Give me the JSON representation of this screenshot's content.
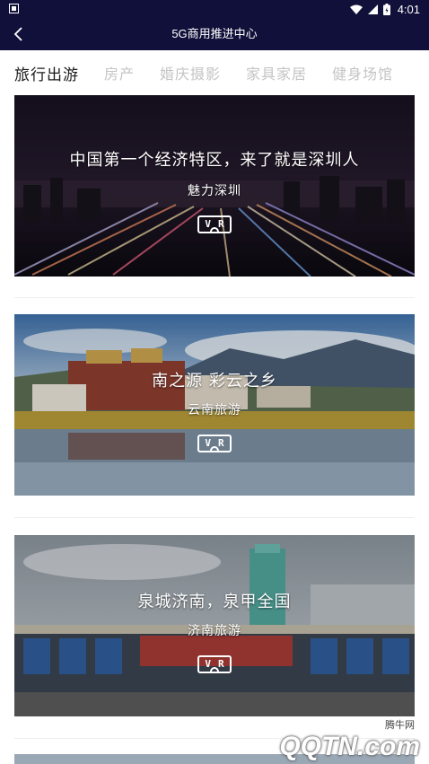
{
  "status": {
    "time": "4:01"
  },
  "header": {
    "title": "5G商用推进中心"
  },
  "tabs": [
    {
      "label": "旅行出游",
      "active": true
    },
    {
      "label": "房产",
      "active": false
    },
    {
      "label": "婚庆摄影",
      "active": false
    },
    {
      "label": "家具家居",
      "active": false
    },
    {
      "label": "健身场馆",
      "active": false
    }
  ],
  "cards": [
    {
      "title": "中国第一个经济特区，来了就是深圳人",
      "subtitle": "魅力深圳",
      "vr_label": "VR"
    },
    {
      "title": "南之源 彩云之乡",
      "subtitle": "云南旅游",
      "vr_label": "VR"
    },
    {
      "title": "泉城济南，泉甲全国",
      "subtitle": "济南旅游",
      "vr_label": "VR"
    }
  ],
  "watermark": {
    "small": "腾牛网",
    "big": "QQTN.com"
  },
  "colors": {
    "header_bg": "#10103a",
    "tab_active": "#1a1a1a",
    "tab_inactive": "#c4c4c4"
  }
}
